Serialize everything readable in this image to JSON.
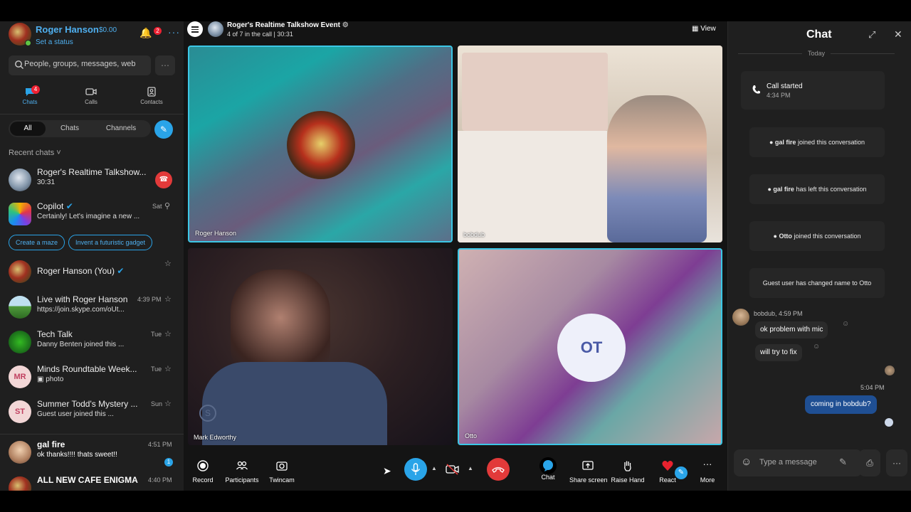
{
  "profile": {
    "name": "Roger Hanson",
    "balance": "$0.00",
    "status": "Set a status",
    "notifications": "2"
  },
  "search": {
    "placeholder": "People, groups, messages, web"
  },
  "nav": {
    "chats": "Chats",
    "chats_badge": "4",
    "calls": "Calls",
    "contacts": "Contacts"
  },
  "filters": {
    "all": "All",
    "chats": "Chats",
    "channels": "Channels"
  },
  "recent_header": "Recent chats",
  "recent_chats": [
    {
      "name": "Roger's Realtime Talkshow...",
      "sub": "30:31",
      "time": ""
    },
    {
      "name": "Copilot",
      "sub": "Certainly! Let's imagine a new ...",
      "time": "Sat"
    },
    {
      "name": "Roger Hanson (You)",
      "sub": "",
      "time": ""
    },
    {
      "name": "Live with Roger Hanson",
      "sub": "https://join.skype.com/oUt...",
      "time": "4:39 PM"
    },
    {
      "name": "Tech Talk",
      "sub": "Danny Benten joined this ...",
      "time": "Tue"
    },
    {
      "name": "Minds Roundtable Week...",
      "sub": "photo",
      "time": "Tue",
      "initials": "MR"
    },
    {
      "name": "Summer Todd's Mystery ...",
      "sub": "Guest user joined this ...",
      "time": "Sun",
      "initials": "ST"
    },
    {
      "name": "gal fire",
      "sub": "ok thanks!!!! thats sweet!!",
      "time": "4:51 PM",
      "unread": "1"
    },
    {
      "name": "ALL NEW CAFE ENIGMA",
      "sub": "",
      "time": "4:40 PM"
    }
  ],
  "suggestions": [
    "Create a maze",
    "Invent a futuristic gadget"
  ],
  "call": {
    "title": "Roger's Realtime Talkshow Event",
    "subtitle": "4 of 7 in the call | 30:31",
    "view": "View",
    "tiles": [
      "Roger Hanson",
      "bobdub",
      "Mark Edworthy",
      "Otto"
    ],
    "otto_initials": "OT"
  },
  "controls": {
    "record": "Record",
    "participants": "Participants",
    "twincam": "Twincam",
    "chat": "Chat",
    "share": "Share screen",
    "raise": "Raise Hand",
    "react": "React",
    "more": "More"
  },
  "chat_panel": {
    "title": "Chat",
    "today": "Today",
    "call_started": "Call started",
    "call_started_time": "4:34 PM",
    "system": [
      {
        "name": "gal fire",
        "text": "joined this conversation"
      },
      {
        "name": "gal fire",
        "text": "has left this conversation"
      },
      {
        "name": "Otto",
        "text": "joined this conversation"
      },
      {
        "name": "",
        "text": "Guest user has changed name to Otto"
      }
    ],
    "sender": "bobdub, 4:59 PM",
    "messages": [
      "ok problem with mic",
      "will try to fix"
    ],
    "out_time": "5:04 PM",
    "out_message": "coming in bobdub?",
    "compose_placeholder": "Type a message"
  },
  "colors": {
    "accent": "#2aa4e8",
    "hangup": "#e23a3a",
    "active_border": "#3cc7e6",
    "outgoing_bubble": "#1f4f93"
  }
}
